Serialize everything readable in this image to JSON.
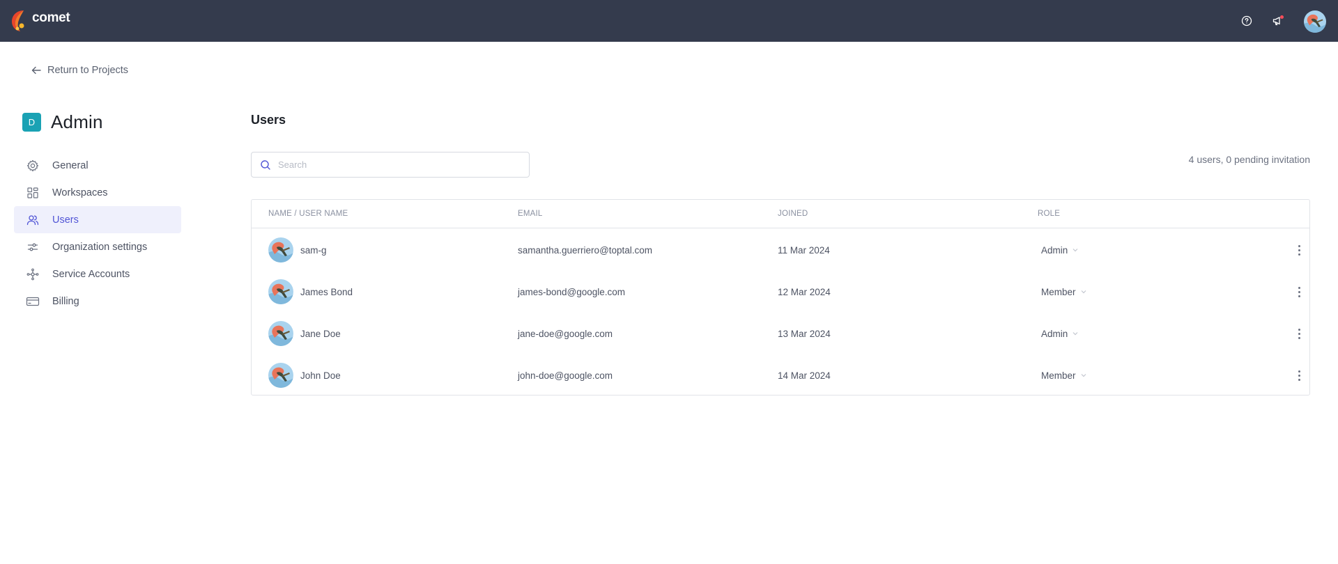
{
  "app": {
    "brand": "comet",
    "colors": {
      "topbar": "#343b4d",
      "accent": "#5155d6",
      "workspace_badge": "#1aa2b4",
      "notification_dot": "#ff4d5a"
    }
  },
  "header": {
    "icons": [
      "help-circle-icon",
      "megaphone-icon",
      "user-avatar"
    ]
  },
  "back_link": {
    "label": "Return to Projects",
    "icon": "arrow-left-icon"
  },
  "workspace": {
    "badge": "D",
    "title": "Admin"
  },
  "sidebar": {
    "items": [
      {
        "label": "General",
        "icon": "gear-icon",
        "active": false
      },
      {
        "label": "Workspaces",
        "icon": "grid-icon",
        "active": false
      },
      {
        "label": "Users",
        "icon": "users-icon",
        "active": true
      },
      {
        "label": "Organization settings",
        "icon": "sliders-icon",
        "active": false
      },
      {
        "label": "Service Accounts",
        "icon": "network-icon",
        "active": false
      },
      {
        "label": "Billing",
        "icon": "credit-card-icon",
        "active": false
      }
    ]
  },
  "main": {
    "title": "Users",
    "search": {
      "placeholder": "Search",
      "value": ""
    },
    "summary": "4 users, 0 pending invitation",
    "table": {
      "columns": [
        "NAME / USER NAME",
        "EMAIL",
        "JOINED",
        "ROLE"
      ],
      "rows": [
        {
          "name": "sam-g",
          "email": "samantha.guerriero@toptal.com",
          "joined": "11 Mar 2024",
          "role": "Admin"
        },
        {
          "name": "James Bond",
          "email": "james-bond@google.com",
          "joined": "12 Mar 2024",
          "role": "Member"
        },
        {
          "name": "Jane Doe",
          "email": "jane-doe@google.com",
          "joined": "13 Mar 2024",
          "role": "Admin"
        },
        {
          "name": "John Doe",
          "email": "john-doe@google.com",
          "joined": "14 Mar 2024",
          "role": "Member"
        }
      ]
    }
  }
}
